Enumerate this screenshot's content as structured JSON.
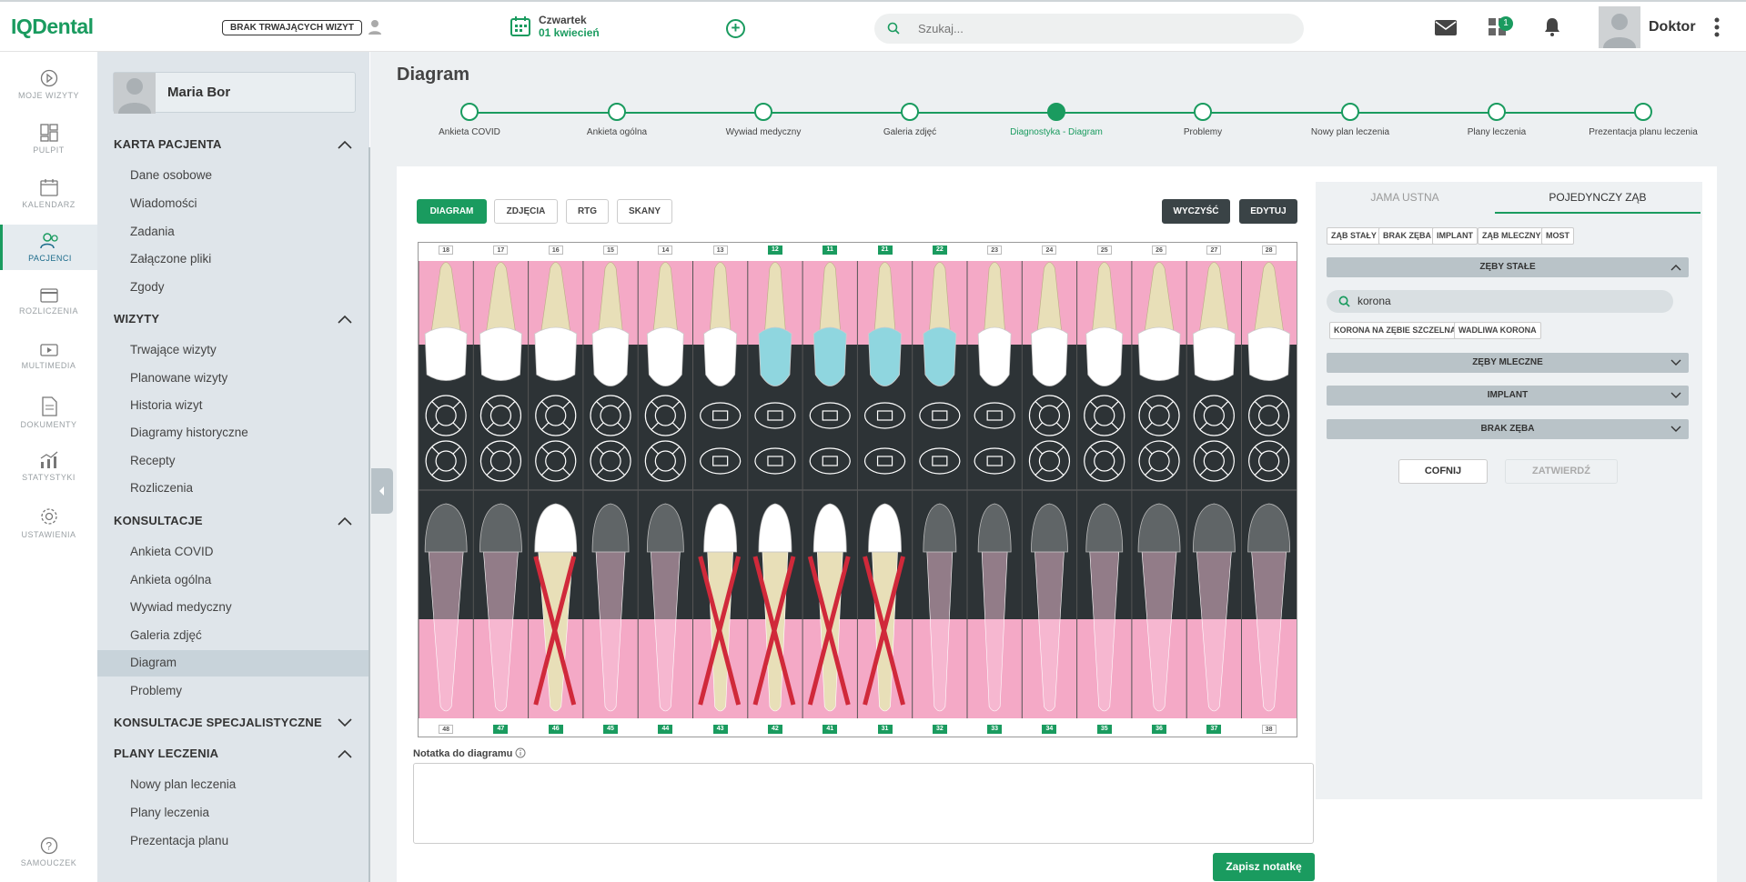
{
  "app": {
    "logo": "IQDental",
    "brak_label": "BRAK TRWAJĄCYCH WIZYT",
    "day": "Czwartek",
    "date": "01 kwiecień",
    "search_placeholder": "Szukaj...",
    "badge": "1",
    "user": "Doktor"
  },
  "rail": [
    {
      "label": "MOJE WIZYTY",
      "icon": "play-circle-icon"
    },
    {
      "label": "PULPIT",
      "icon": "dashboard-icon"
    },
    {
      "label": "KALENDARZ",
      "icon": "calendar-icon"
    },
    {
      "label": "PACJENCI",
      "icon": "users-icon",
      "active": true
    },
    {
      "label": "ROZLICZENIA",
      "icon": "card-icon"
    },
    {
      "label": "MULTIMEDIA",
      "icon": "media-icon"
    },
    {
      "label": "DOKUMENTY",
      "icon": "document-icon"
    },
    {
      "label": "STATYSTYKI",
      "icon": "stats-icon"
    },
    {
      "label": "USTAWIENIA",
      "icon": "gear-icon"
    },
    {
      "label": "SAMOUCZEK",
      "icon": "help-icon"
    }
  ],
  "sidebar": {
    "patient": "Maria Bor",
    "sections": [
      {
        "title": "KARTA PACJENTA",
        "items": [
          "Dane osobowe",
          "Wiadomości",
          "Zadania",
          "Załączone pliki",
          "Zgody"
        ]
      },
      {
        "title": "WIZYTY",
        "items": [
          "Trwające wizyty",
          "Planowane wizyty",
          "Historia wizyt",
          "Diagramy historyczne",
          "Recepty",
          "Rozliczenia"
        ]
      },
      {
        "title": "KONSULTACJE",
        "items": [
          "Ankieta COVID",
          "Ankieta ogólna",
          "Wywiad medyczny",
          "Galeria zdjęć",
          "Diagram",
          "Problemy"
        ]
      },
      {
        "title": "KONSULTACJE SPECJALISTYCZNE",
        "items": []
      },
      {
        "title": "PLANY LECZENIA",
        "items": [
          "Nowy plan leczenia",
          "Plany leczenia",
          "Prezentacja planu"
        ]
      }
    ]
  },
  "main": {
    "title": "Diagram",
    "steps": [
      "Ankieta COVID",
      "Ankieta ogólna",
      "Wywiad medyczny",
      "Galeria zdjęć",
      "Diagnostyka - Diagram",
      "Problemy",
      "Nowy plan leczenia",
      "Plany leczenia",
      "Prezentacja planu leczenia"
    ],
    "current_step": 4,
    "tabs": [
      "DIAGRAM",
      "ZDJĘCIA",
      "RTG",
      "SKANY"
    ],
    "clear": "WYCZYŚĆ",
    "edit": "EDYTUJ",
    "upper_teeth": [
      "18",
      "17",
      "16",
      "15",
      "14",
      "13",
      "12",
      "11",
      "21",
      "22",
      "23",
      "24",
      "25",
      "26",
      "27",
      "28"
    ],
    "lower_teeth": [
      "48",
      "47",
      "46",
      "45",
      "44",
      "43",
      "42",
      "41",
      "31",
      "32",
      "33",
      "34",
      "35",
      "36",
      "37",
      "38"
    ],
    "upper_highlight": [
      "12",
      "11",
      "21",
      "22"
    ],
    "lower_highlight": [
      "47",
      "46",
      "45",
      "44",
      "43",
      "42",
      "41",
      "31",
      "32",
      "33",
      "34",
      "35",
      "36",
      "37"
    ],
    "crowned": [
      "12",
      "11",
      "21",
      "22"
    ],
    "extracted": [
      "46",
      "43",
      "42",
      "41",
      "31"
    ],
    "note_label": "Notatka do diagramu",
    "save": "Zapisz notatkę"
  },
  "right": {
    "tabs": [
      "JAMA USTNA",
      "POJEDYNCZY ZĄB"
    ],
    "tags": [
      "ZĄB STAŁY",
      "BRAK ZĘBA",
      "IMPLANT",
      "ZĄB MLECZNY",
      "MOST"
    ],
    "acc1": "ZĘBY STAŁE",
    "search": "korona",
    "results": [
      "KORONA NA ZĘBIE SZCZELNA",
      "WADLIWA KORONA"
    ],
    "acc2": "ZĘBY MLECZNE",
    "acc3": "IMPLANT",
    "acc4": "BRAK ZĘBA",
    "back": "COFNIJ",
    "confirm": "ZATWIERDŹ"
  }
}
